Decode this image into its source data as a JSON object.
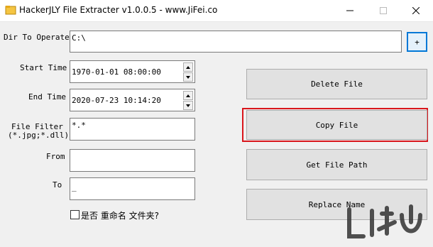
{
  "window": {
    "title": "HackerJLY File Extracter v1.0.0.5 - www.JiFei.co",
    "minimize_glyph": "—",
    "maximize_glyph": "☐",
    "close_glyph": "✕"
  },
  "form": {
    "dir_label": "Dir To Operate",
    "dir_value": "C:\\",
    "browse_label": "+",
    "start_time_label": "Start Time",
    "start_time_value": "1970-01-01 08:00:00",
    "end_time_label": "End Time",
    "end_time_value": "2020-07-23 10:14:20",
    "file_filter_label_line1": "File Filter",
    "file_filter_label_line2": "(*.jpg;*.dll)",
    "file_filter_value": "*.*",
    "from_label": "From",
    "from_value": "",
    "to_label": "To",
    "to_value": "_",
    "checkbox_label": "是否 重命名 文件夹?"
  },
  "actions": {
    "delete_label": "Delete File",
    "copy_label": "Copy File",
    "get_path_label": "Get File Path",
    "replace_label": "Replace Name"
  },
  "colors": {
    "highlight": "#d9161c",
    "window_bg": "#f0f0f0",
    "button_bg": "#e1e1e1",
    "accent": "#0078d7"
  }
}
